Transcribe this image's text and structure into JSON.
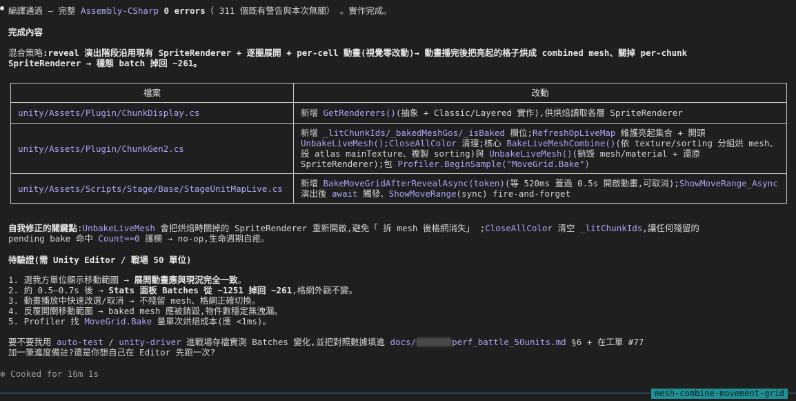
{
  "status": {
    "prefix": "編譯通過 — 完整 ",
    "assembly": "Assembly-CSharp",
    "errors": " 0 errors",
    "suffix": "（ 311 個既有警告與本次無關） 。實作完成。"
  },
  "section_done": "完成內容",
  "strategy": {
    "label": "混合策略",
    "line1": ":reveal 演出階段沿用現有 SpriteRenderer + 逐圈展開 + per-cell 動畫(視覺零改動)→ 動畫播完後把亮起的格子烘成 combined mesh、關掉 per-chunk",
    "line2": "SpriteRenderer → 穩態 batch 掉回 ~261。"
  },
  "table": {
    "headers": [
      "檔案",
      "改動"
    ],
    "rows": [
      {
        "file": "unity/Assets/Plugin/ChunkDisplay.cs",
        "change": [
          {
            "t": "新增 "
          },
          {
            "t": "GetRenderers()",
            "hi": true
          },
          {
            "t": "(抽象 + Classic/Layered 實作),供烘焙讀取各層 SpriteRenderer"
          }
        ]
      },
      {
        "file": "unity/Assets/Plugin/ChunkGen2.cs",
        "change": [
          {
            "t": "新增 "
          },
          {
            "t": "_litChunkIds/_bakedMeshGos/_isBaked",
            "hi": true
          },
          {
            "t": " 欄位;"
          },
          {
            "t": "RefreshOpLiveMap",
            "hi": true
          },
          {
            "t": " 維護亮起集合 + 開頭 "
          },
          {
            "t": "UnbakeLiveMesh();CloseAllColor",
            "hi": true
          },
          {
            "t": " 清理;核心 "
          },
          {
            "t": "BakeLiveMeshCombine()",
            "hi": true
          },
          {
            "t": "(依 texture/sorting 分組烘 mesh、設 atlas mainTexture、複製 sorting)與 "
          },
          {
            "t": "UnbakeLiveMesh()",
            "hi": true
          },
          {
            "t": "(銷毀 mesh/material + 還原 SpriteRenderer);包 "
          },
          {
            "t": "Profiler.BeginSample(\"MoveGrid.Bake\")",
            "hi": true
          }
        ]
      },
      {
        "file": "unity/Assets/Scripts/Stage/Base/StageUnitMapLive.cs",
        "change": [
          {
            "t": "新增 "
          },
          {
            "t": "BakeMoveGridAfterRevealAsync(token)",
            "hi": true
          },
          {
            "t": "(等 520ms 蓋過 0.5s 開啟動畫,可取消);"
          },
          {
            "t": "ShowMoveRange_Async",
            "hi": true
          },
          {
            "t": " 演出後 "
          },
          {
            "t": "await",
            "hi": true
          },
          {
            "t": " 觸發、"
          },
          {
            "t": "ShowMoveRange",
            "hi": true
          },
          {
            "t": "(sync) fire-and-forget"
          }
        ]
      }
    ]
  },
  "fix": {
    "label": "自我修正的關鍵點",
    "p1": ":",
    "code1": "UnbakeLiveMesh",
    "p2": " 會把烘焙時關掉的 SpriteRenderer 重新開啟,避免「 拆 mesh 後格網消失」 ;",
    "code2": "CloseAllColor",
    "p3": " 清空 ",
    "code3": "_litChunkIds",
    "p4": ",讓任何殘留的",
    "p5": "pending bake 命中 ",
    "code4": "Count==0",
    "p6": " 護欄 → no-op,生命週期自癒。"
  },
  "section_verify": "待驗證(需 Unity Editor / 戰場 50 單位)",
  "steps": [
    [
      {
        "t": "1. 選我方單位顯示移動範圍 → "
      },
      {
        "t": "展開動畫應與現況完全一致",
        "b": true
      },
      {
        "t": "。"
      }
    ],
    [
      {
        "t": "2. 約 0.5–0.7s 後 → "
      },
      {
        "t": "Stats 面板 Batches 從 ~1251 掉回 ~261",
        "b": true
      },
      {
        "t": ",格網外觀不變。"
      }
    ],
    [
      {
        "t": "3. 動畫播放中快速改選/取消 → 不殘留 mesh、格網正確切換。"
      }
    ],
    [
      {
        "t": "4. 反覆開關移動範圍 → baked mesh 應被銷毀,物件數穩定無洩漏。"
      }
    ],
    [
      {
        "t": "5. Profiler 找 "
      },
      {
        "t": "MoveGrid.Bake",
        "hi": true
      },
      {
        "t": " 量單次烘焙成本(應 <1ms)。"
      }
    ]
  ],
  "question": {
    "p1": "要不要我用 ",
    "tool1": "auto-test",
    "sep": " / ",
    "tool2": "unity-driver",
    "p2": " 進戰場存檔實測 Batches 變化,並把對照數據填進 ",
    "doc_a": "docs/",
    "doc_b": "perf_battle_50units.md",
    "p3": " §6 + 在工單 ",
    "ticket": "#77",
    "line2": "加一筆進度備註?還是你想自己在 Editor 先跑一次?"
  },
  "cooked": "✻ Cooked for 16m 1s",
  "branch": "mesh-combine-movement-grid",
  "colors": {
    "accent": "#a9a6f5",
    "branch_bg": "#1e8f95",
    "bg": "#1f1f1f"
  }
}
